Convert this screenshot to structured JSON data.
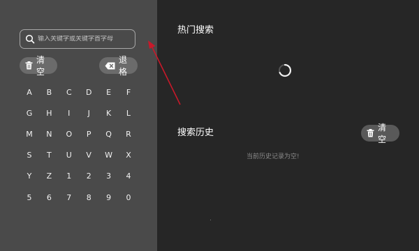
{
  "search": {
    "placeholder": "输入关键字或关键字首字母",
    "value": ""
  },
  "actions": {
    "clear_label": "清空",
    "backspace_label": "退格"
  },
  "keyboard": {
    "rows": [
      [
        "A",
        "B",
        "C",
        "D",
        "E",
        "F"
      ],
      [
        "G",
        "H",
        "I",
        "J",
        "K",
        "L"
      ],
      [
        "M",
        "N",
        "O",
        "P",
        "Q",
        "R"
      ],
      [
        "S",
        "T",
        "U",
        "V",
        "W",
        "X"
      ],
      [
        "Y",
        "Z",
        "1",
        "2",
        "3",
        "4"
      ],
      [
        "5",
        "6",
        "7",
        "8",
        "9",
        "0"
      ]
    ]
  },
  "hot_search": {
    "title": "热门搜索",
    "loading": true
  },
  "history": {
    "title": "搜索历史",
    "clear_label": "清空",
    "empty_text": "当前历史记录为空!"
  },
  "colors": {
    "left_panel": "#4a4a4a",
    "right_panel": "#262626",
    "pill": "#6b6b6b",
    "annotation_arrow": "#c8192a"
  },
  "icons": [
    "search-icon",
    "trash-icon",
    "backspace-icon",
    "loading-spinner-icon"
  ]
}
